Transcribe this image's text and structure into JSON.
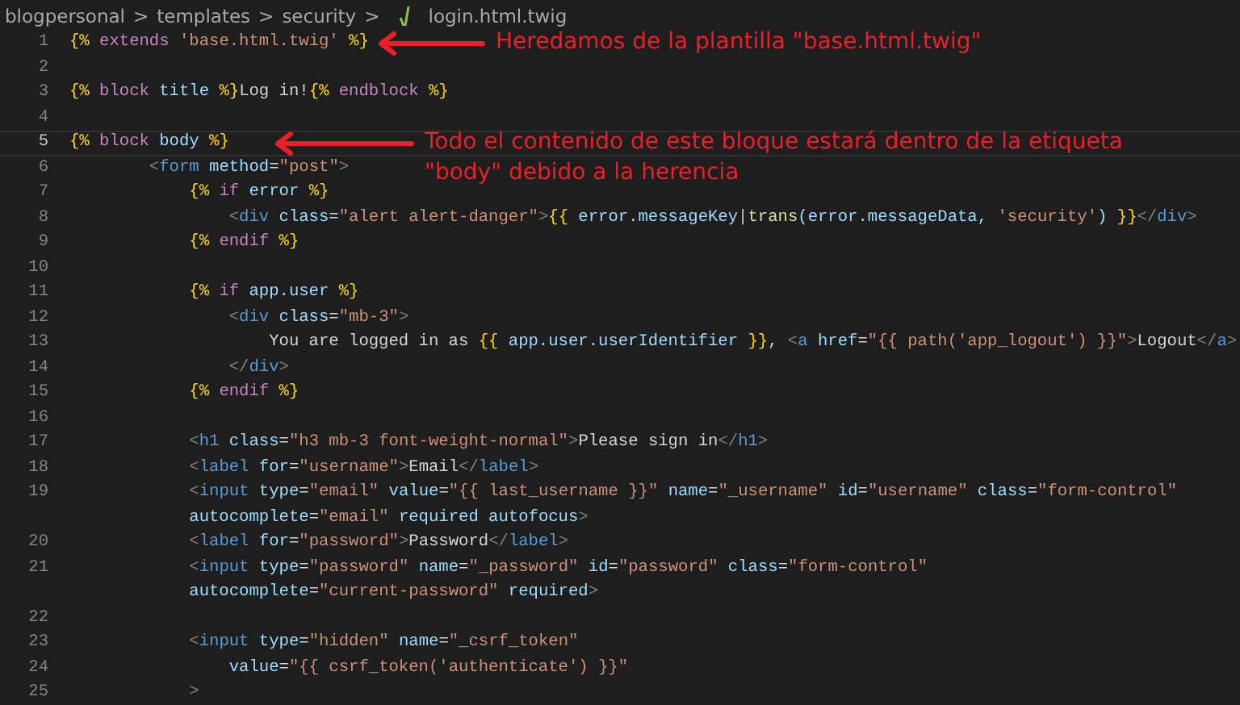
{
  "breadcrumbs": {
    "segments": [
      "blogpersonal",
      "templates",
      "security"
    ],
    "separator": ">",
    "file": "login.html.twig"
  },
  "lines": [
    {
      "number": "1",
      "current": false,
      "tokens": [
        {
          "kind": "brace",
          "text": "{%"
        },
        {
          "kind": "keyword",
          "text": " extends "
        },
        {
          "kind": "string",
          "text": "'base.html.twig'"
        },
        {
          "kind": "brace",
          "text": " %}"
        }
      ]
    },
    {
      "number": "2",
      "current": false
    },
    {
      "number": "3",
      "current": false,
      "tokens": [
        {
          "kind": "brace",
          "text": "{%"
        },
        {
          "kind": "keyword",
          "text": " block "
        },
        {
          "kind": "variable",
          "text": "title"
        },
        {
          "kind": "brace",
          "text": " %}"
        },
        {
          "kind": "plain",
          "text": "Log in!"
        },
        {
          "kind": "brace",
          "text": "{%"
        },
        {
          "kind": "keyword",
          "text": " endblock "
        },
        {
          "kind": "brace",
          "text": "%}"
        }
      ]
    },
    {
      "number": "4",
      "current": false
    },
    {
      "number": "5",
      "current": true,
      "tokens": [
        {
          "kind": "brace",
          "text": "{%"
        },
        {
          "kind": "keyword",
          "text": " block "
        },
        {
          "kind": "variable",
          "text": "body"
        },
        {
          "kind": "brace",
          "text": " %}"
        }
      ]
    },
    {
      "number": "6",
      "current": false,
      "tokens": [
        {
          "kind": "bracket",
          "text": "        <"
        },
        {
          "kind": "tag",
          "text": "form"
        },
        {
          "kind": "attribute",
          "text": " method"
        },
        {
          "kind": "plain",
          "text": "="
        },
        {
          "kind": "string",
          "text": "\"post\""
        },
        {
          "kind": "bracket",
          "text": ">"
        }
      ]
    },
    {
      "number": "7",
      "current": false,
      "tokens": [
        {
          "kind": "brace",
          "text": "            {%"
        },
        {
          "kind": "keyword",
          "text": " if "
        },
        {
          "kind": "variable",
          "text": "error"
        },
        {
          "kind": "brace",
          "text": " %}"
        }
      ]
    },
    {
      "number": "8",
      "current": false,
      "tokens": [
        {
          "kind": "bracket",
          "text": "                <"
        },
        {
          "kind": "tag",
          "text": "div"
        },
        {
          "kind": "attribute",
          "text": " class"
        },
        {
          "kind": "plain",
          "text": "="
        },
        {
          "kind": "string",
          "text": "\"alert alert-danger\""
        },
        {
          "kind": "bracket",
          "text": ">"
        },
        {
          "kind": "brace",
          "text": "{{"
        },
        {
          "kind": "variable",
          "text": " error.messageKey"
        },
        {
          "kind": "plain",
          "text": "|"
        },
        {
          "kind": "function",
          "text": "trans"
        },
        {
          "kind": "variable",
          "text": "(error.messageData, "
        },
        {
          "kind": "string",
          "text": "'security'"
        },
        {
          "kind": "variable",
          "text": ") "
        },
        {
          "kind": "brace",
          "text": "}}"
        },
        {
          "kind": "bracket",
          "text": "</"
        },
        {
          "kind": "tag",
          "text": "div"
        },
        {
          "kind": "bracket",
          "text": ">"
        }
      ]
    },
    {
      "number": "9",
      "current": false,
      "tokens": [
        {
          "kind": "brace",
          "text": "            {%"
        },
        {
          "kind": "keyword",
          "text": " endif "
        },
        {
          "kind": "brace",
          "text": "%}"
        }
      ]
    },
    {
      "number": "10",
      "current": false
    },
    {
      "number": "11",
      "current": false,
      "tokens": [
        {
          "kind": "brace",
          "text": "            {%"
        },
        {
          "kind": "keyword",
          "text": " if "
        },
        {
          "kind": "variable",
          "text": "app.user"
        },
        {
          "kind": "brace",
          "text": " %}"
        }
      ]
    },
    {
      "number": "12",
      "current": false,
      "tokens": [
        {
          "kind": "bracket",
          "text": "                <"
        },
        {
          "kind": "tag",
          "text": "div"
        },
        {
          "kind": "attribute",
          "text": " class"
        },
        {
          "kind": "plain",
          "text": "="
        },
        {
          "kind": "string",
          "text": "\"mb-3\""
        },
        {
          "kind": "bracket",
          "text": ">"
        }
      ]
    },
    {
      "number": "13",
      "current": false,
      "tokens": [
        {
          "kind": "plain",
          "text": "                    You are logged in as "
        },
        {
          "kind": "brace",
          "text": "{{"
        },
        {
          "kind": "variable",
          "text": " app.user.userIdentifier "
        },
        {
          "kind": "brace",
          "text": "}}"
        },
        {
          "kind": "plain",
          "text": ", "
        },
        {
          "kind": "bracket",
          "text": "<"
        },
        {
          "kind": "tag",
          "text": "a"
        },
        {
          "kind": "attribute",
          "text": " href"
        },
        {
          "kind": "plain",
          "text": "="
        },
        {
          "kind": "string",
          "text": "\"{{ path('app_logout') }}\""
        },
        {
          "kind": "bracket",
          "text": ">"
        },
        {
          "kind": "plain",
          "text": "Logout"
        },
        {
          "kind": "bracket",
          "text": "</"
        },
        {
          "kind": "tag",
          "text": "a"
        },
        {
          "kind": "bracket",
          "text": ">"
        }
      ]
    },
    {
      "number": "14",
      "current": false,
      "tokens": [
        {
          "kind": "bracket",
          "text": "                </"
        },
        {
          "kind": "tag",
          "text": "div"
        },
        {
          "kind": "bracket",
          "text": ">"
        }
      ]
    },
    {
      "number": "15",
      "current": false,
      "tokens": [
        {
          "kind": "brace",
          "text": "            {%"
        },
        {
          "kind": "keyword",
          "text": " endif "
        },
        {
          "kind": "brace",
          "text": "%}"
        }
      ]
    },
    {
      "number": "16",
      "current": false
    },
    {
      "number": "17",
      "current": false,
      "tokens": [
        {
          "kind": "bracket",
          "text": "            <"
        },
        {
          "kind": "tag",
          "text": "h1"
        },
        {
          "kind": "attribute",
          "text": " class"
        },
        {
          "kind": "plain",
          "text": "="
        },
        {
          "kind": "string",
          "text": "\"h3 mb-3 font-weight-normal\""
        },
        {
          "kind": "bracket",
          "text": ">"
        },
        {
          "kind": "plain",
          "text": "Please sign in"
        },
        {
          "kind": "bracket",
          "text": "</"
        },
        {
          "kind": "tag",
          "text": "h1"
        },
        {
          "kind": "bracket",
          "text": ">"
        }
      ]
    },
    {
      "number": "18",
      "current": false,
      "tokens": [
        {
          "kind": "bracket",
          "text": "            <"
        },
        {
          "kind": "tag",
          "text": "label"
        },
        {
          "kind": "attribute",
          "text": " for"
        },
        {
          "kind": "plain",
          "text": "="
        },
        {
          "kind": "string",
          "text": "\"username\""
        },
        {
          "kind": "bracket",
          "text": ">"
        },
        {
          "kind": "plain",
          "text": "Email"
        },
        {
          "kind": "bracket",
          "text": "</"
        },
        {
          "kind": "tag",
          "text": "label"
        },
        {
          "kind": "bracket",
          "text": ">"
        }
      ]
    },
    {
      "number": "19",
      "current": false,
      "tokens": [
        {
          "kind": "bracket",
          "text": "            <"
        },
        {
          "kind": "tag",
          "text": "input"
        },
        {
          "kind": "attribute",
          "text": " type"
        },
        {
          "kind": "plain",
          "text": "="
        },
        {
          "kind": "string",
          "text": "\"email\""
        },
        {
          "kind": "attribute",
          "text": " value"
        },
        {
          "kind": "plain",
          "text": "="
        },
        {
          "kind": "string",
          "text": "\"{{ last_username }}\""
        },
        {
          "kind": "attribute",
          "text": " name"
        },
        {
          "kind": "plain",
          "text": "="
        },
        {
          "kind": "string",
          "text": "\"_username\""
        },
        {
          "kind": "attribute",
          "text": " id"
        },
        {
          "kind": "plain",
          "text": "="
        },
        {
          "kind": "string",
          "text": "\"username\""
        },
        {
          "kind": "attribute",
          "text": " class"
        },
        {
          "kind": "plain",
          "text": "="
        },
        {
          "kind": "string",
          "text": "\"form-control\""
        }
      ],
      "wrapped": [
        {
          "kind": "attribute",
          "text": "            autocomplete"
        },
        {
          "kind": "plain",
          "text": "="
        },
        {
          "kind": "string",
          "text": "\"email\""
        },
        {
          "kind": "attribute",
          "text": " required autofocus"
        },
        {
          "kind": "bracket",
          "text": ">"
        }
      ]
    },
    {
      "number": "20",
      "current": false,
      "tokens": [
        {
          "kind": "bracket",
          "text": "            <"
        },
        {
          "kind": "tag",
          "text": "label"
        },
        {
          "kind": "attribute",
          "text": " for"
        },
        {
          "kind": "plain",
          "text": "="
        },
        {
          "kind": "string",
          "text": "\"password\""
        },
        {
          "kind": "bracket",
          "text": ">"
        },
        {
          "kind": "plain",
          "text": "Password"
        },
        {
          "kind": "bracket",
          "text": "</"
        },
        {
          "kind": "tag",
          "text": "label"
        },
        {
          "kind": "bracket",
          "text": ">"
        }
      ]
    },
    {
      "number": "21",
      "current": false,
      "tokens": [
        {
          "kind": "bracket",
          "text": "            <"
        },
        {
          "kind": "tag",
          "text": "input"
        },
        {
          "kind": "attribute",
          "text": " type"
        },
        {
          "kind": "plain",
          "text": "="
        },
        {
          "kind": "string",
          "text": "\"password\""
        },
        {
          "kind": "attribute",
          "text": " name"
        },
        {
          "kind": "plain",
          "text": "="
        },
        {
          "kind": "string",
          "text": "\"_password\""
        },
        {
          "kind": "attribute",
          "text": " id"
        },
        {
          "kind": "plain",
          "text": "="
        },
        {
          "kind": "string",
          "text": "\"password\""
        },
        {
          "kind": "attribute",
          "text": " class"
        },
        {
          "kind": "plain",
          "text": "="
        },
        {
          "kind": "string",
          "text": "\"form-control\""
        }
      ],
      "wrapped": [
        {
          "kind": "attribute",
          "text": "            autocomplete"
        },
        {
          "kind": "plain",
          "text": "="
        },
        {
          "kind": "string",
          "text": "\"current-password\""
        },
        {
          "kind": "attribute",
          "text": " required"
        },
        {
          "kind": "bracket",
          "text": ">"
        }
      ]
    },
    {
      "number": "22",
      "current": false
    },
    {
      "number": "23",
      "current": false,
      "tokens": [
        {
          "kind": "bracket",
          "text": "            <"
        },
        {
          "kind": "tag",
          "text": "input"
        },
        {
          "kind": "attribute",
          "text": " type"
        },
        {
          "kind": "plain",
          "text": "="
        },
        {
          "kind": "string",
          "text": "\"hidden\""
        },
        {
          "kind": "attribute",
          "text": " name"
        },
        {
          "kind": "plain",
          "text": "="
        },
        {
          "kind": "string",
          "text": "\"_csrf_token\""
        }
      ]
    },
    {
      "number": "24",
      "current": false,
      "tokens": [
        {
          "kind": "attribute",
          "text": "                value"
        },
        {
          "kind": "plain",
          "text": "="
        },
        {
          "kind": "string",
          "text": "\"{{ csrf_token('authenticate') }}\""
        }
      ]
    },
    {
      "number": "25",
      "current": false,
      "tokens": [
        {
          "kind": "bracket",
          "text": "            >"
        }
      ]
    }
  ],
  "annotations": [
    "Heredamos de la plantilla \"base.html.twig\"",
    "Todo el contenido de este bloque estará dentro de la etiqueta \"body\" debido a la herencia"
  ]
}
